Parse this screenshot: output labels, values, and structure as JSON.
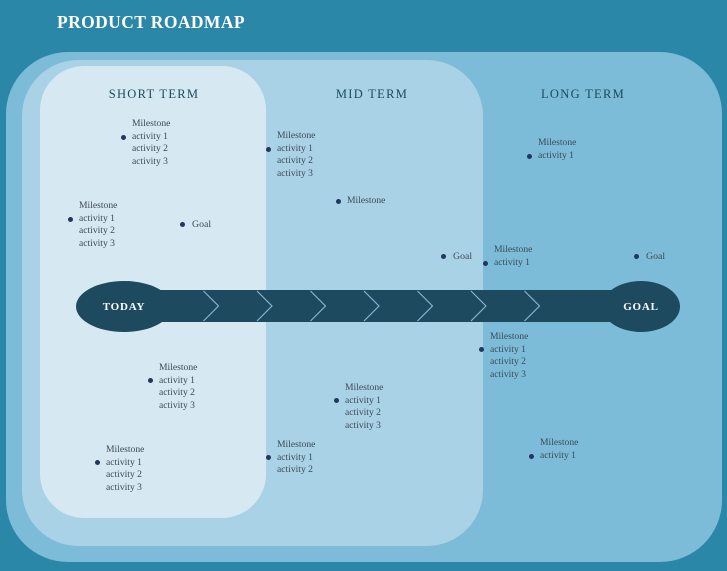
{
  "title": "PRODUCT ROADMAP",
  "colors": {
    "page_background": "#2b87a8",
    "outer_panel": "#7cbcd8",
    "short_term_panel": "#d6e8f2",
    "mid_term_panel": "#a9d2e6",
    "long_term_panel": "#7cbcd8",
    "timeline_bar": "#1d4a5e",
    "marker_dot": "#22365e",
    "heading_text": "#1d4a5e",
    "body_text": "#3c4a55",
    "title_text": "#ffffff"
  },
  "phases": [
    {
      "id": "short",
      "label": "SHORT TERM"
    },
    {
      "id": "mid",
      "label": "MID TERM"
    },
    {
      "id": "long",
      "label": "LONG TERM"
    }
  ],
  "timeline": {
    "start_label": "TODAY",
    "end_label": "GOAL",
    "chevron_count": 8
  },
  "milestones": [
    {
      "id": "s1",
      "phase": "short",
      "position": "above",
      "dot_side": "left",
      "title": "Milestone",
      "activities": [
        "activity 1",
        "activity 2",
        "activity 3"
      ]
    },
    {
      "id": "s2",
      "phase": "short",
      "position": "above",
      "dot_side": "left",
      "title": "Milestone",
      "activities": [
        "activity 1",
        "activity 2",
        "activity 3"
      ]
    },
    {
      "id": "m1",
      "phase": "mid",
      "position": "above",
      "dot_side": "left",
      "title": "Milestone",
      "activities": [
        "activity 1",
        "activity 2",
        "activity 3"
      ]
    },
    {
      "id": "m2",
      "phase": "mid",
      "position": "above",
      "dot_side": "left",
      "title": "Milestone",
      "activities": []
    },
    {
      "id": "l1",
      "phase": "long",
      "position": "above",
      "dot_side": "left",
      "title": "Milestone",
      "activities": [
        "activity 1"
      ]
    },
    {
      "id": "l2",
      "phase": "long",
      "position": "above",
      "dot_side": "left",
      "title": "Milestone",
      "activities": [
        "activity 1"
      ]
    },
    {
      "id": "s3",
      "phase": "short",
      "position": "below",
      "dot_side": "left",
      "title": "Milestone",
      "activities": [
        "activity 1",
        "activity 2",
        "activity 3"
      ]
    },
    {
      "id": "s4",
      "phase": "short",
      "position": "below",
      "dot_side": "left",
      "title": "Milestone",
      "activities": [
        "activity 1",
        "activity 2",
        "activity 3"
      ]
    },
    {
      "id": "m3",
      "phase": "mid",
      "position": "below",
      "dot_side": "left",
      "title": "Milestone",
      "activities": [
        "activity 1",
        "activity 2",
        "activity 3"
      ]
    },
    {
      "id": "m4",
      "phase": "mid",
      "position": "below",
      "dot_side": "left",
      "title": "Milestone",
      "activities": [
        "activity 1",
        "activity 2"
      ]
    },
    {
      "id": "l3",
      "phase": "long",
      "position": "below",
      "dot_side": "left",
      "title": "Milestone",
      "activities": [
        "activity 1",
        "activity 2",
        "activity 3"
      ]
    },
    {
      "id": "l4",
      "phase": "long",
      "position": "below",
      "dot_side": "left",
      "title": "Milestone",
      "activities": [
        "activity 1"
      ]
    }
  ],
  "goals": [
    {
      "id": "g1",
      "phase": "short",
      "label": "Goal"
    },
    {
      "id": "g2",
      "phase": "mid",
      "label": "Goal"
    },
    {
      "id": "g3",
      "phase": "long",
      "label": "Goal"
    }
  ]
}
